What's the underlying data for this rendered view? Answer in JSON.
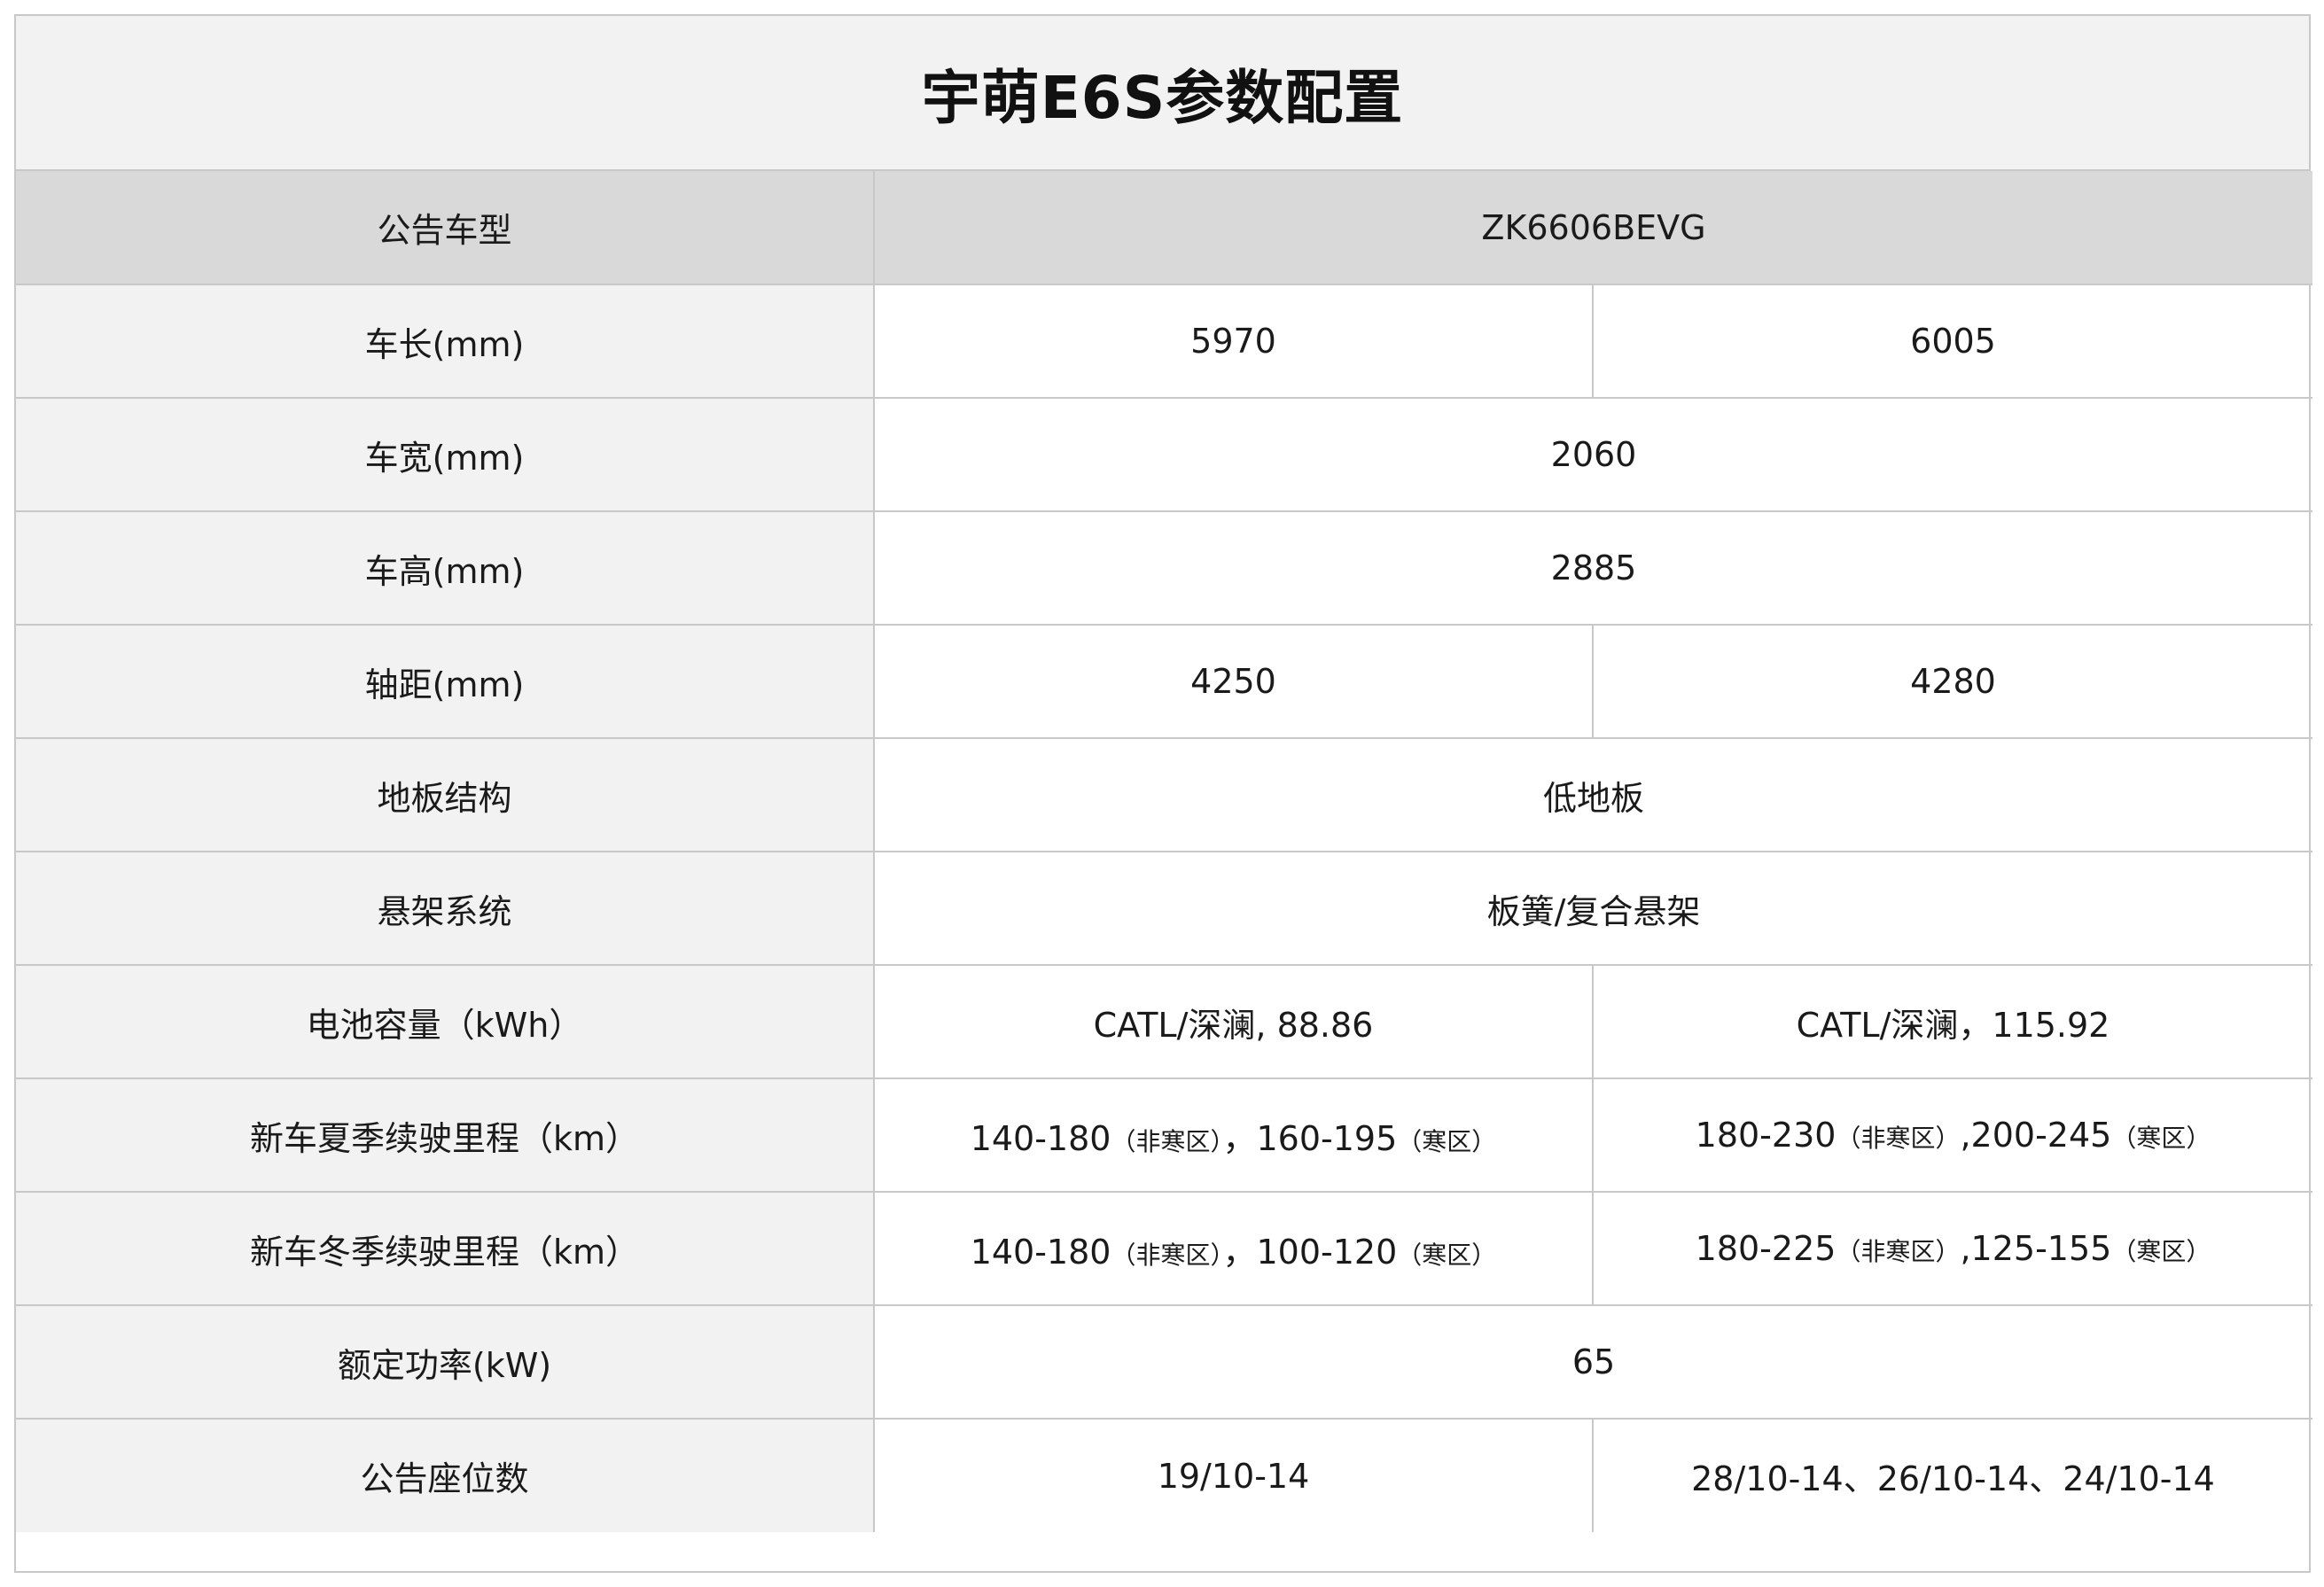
{
  "title": "宇萌E6S参数配置",
  "header": {
    "label": "公告车型",
    "value": "ZK6606BEVG"
  },
  "rows": [
    {
      "label": "车长(mm)",
      "values": [
        "5970",
        "6005"
      ]
    },
    {
      "label": "车宽(mm)",
      "values": [
        "2060"
      ]
    },
    {
      "label": "车高(mm)",
      "values": [
        "2885"
      ]
    },
    {
      "label": "轴距(mm)",
      "values": [
        "4250",
        "4280"
      ]
    },
    {
      "label": "地板结构",
      "values": [
        "低地板"
      ]
    },
    {
      "label": "悬架系统",
      "values": [
        "板簧/复合悬架"
      ]
    },
    {
      "label": "电池容量（kWh）",
      "values": [
        "CATL/深澜, 88.86",
        "CATL/深澜，115.92"
      ]
    },
    {
      "label": "新车夏季续驶里程（km）",
      "values": [
        {
          "a": "140-180",
          "a_note": "（非寒区）",
          "sep": "，",
          "b": "160-195",
          "b_note": "（寒区）"
        },
        {
          "a": "180-230",
          "a_note": "（非寒区）",
          "sep": ",",
          "b": "200-245",
          "b_note": "（寒区）"
        }
      ]
    },
    {
      "label": "新车冬季续驶里程（km）",
      "values": [
        {
          "a": "140-180",
          "a_note": "（非寒区）",
          "sep": "，",
          "b": "100-120",
          "b_note": "（寒区）"
        },
        {
          "a": "180-225",
          "a_note": "（非寒区）",
          "sep": ",",
          "b": "125-155",
          "b_note": "（寒区）"
        }
      ]
    },
    {
      "label": "额定功率(kW)",
      "values": [
        "65"
      ]
    },
    {
      "label": "公告座位数",
      "values": [
        "19/10-14",
        "28/10-14、26/10-14、24/10-14"
      ]
    }
  ]
}
